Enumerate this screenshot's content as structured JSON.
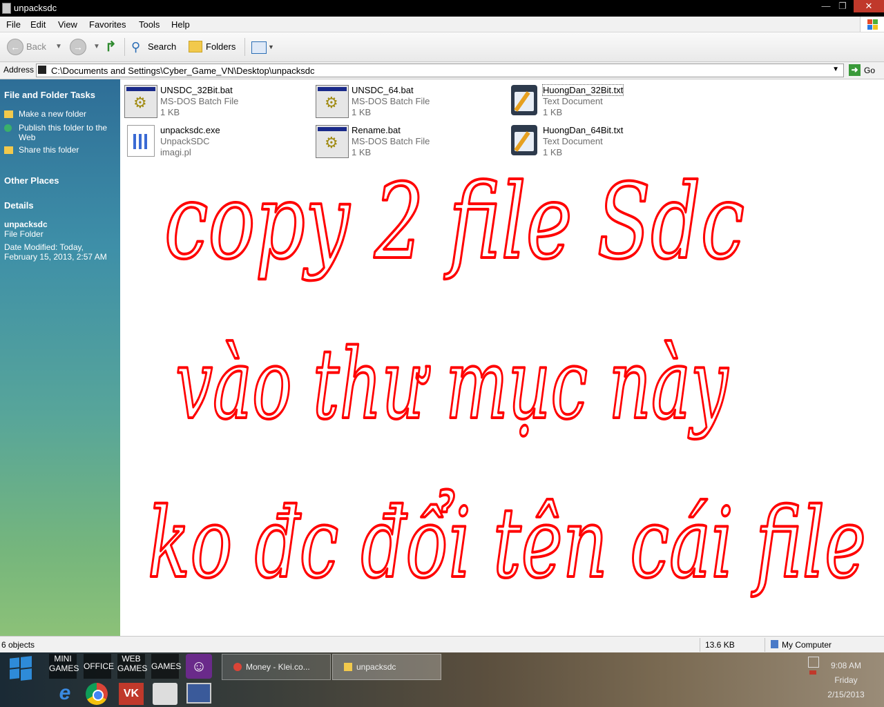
{
  "window": {
    "title": "unpacksdc"
  },
  "menu": {
    "items": [
      "File",
      "Edit",
      "View",
      "Favorites",
      "Tools",
      "Help"
    ]
  },
  "toolbar": {
    "back_label": "Back",
    "search_label": "Search",
    "folders_label": "Folders"
  },
  "address": {
    "label": "Address",
    "path": "C:\\Documents and Settings\\Cyber_Game_VN\\Desktop\\unpacksdc",
    "go_label": "Go"
  },
  "left_pane": {
    "tasks_title": "File and Folder Tasks",
    "tasks": [
      "Make a new folder",
      "Publish this folder to the Web",
      "Share this folder"
    ],
    "other_places_title": "Other Places",
    "details_title": "Details",
    "details": {
      "name": "unpacksdc",
      "type": "File Folder",
      "modified": "Date Modified: Today, February 15, 2013, 2:57 AM"
    }
  },
  "files": [
    {
      "name": "UNSDC_32Bit.bat",
      "type": "MS-DOS Batch File",
      "size": "1 KB",
      "icon": "batch-file-icon"
    },
    {
      "name": "UNSDC_64.bat",
      "type": "MS-DOS Batch File",
      "size": "1 KB",
      "icon": "batch-file-icon"
    },
    {
      "name": "HuongDan_32Bit.txt",
      "type": "Text Document",
      "size": "1 KB",
      "icon": "text-file-icon"
    },
    {
      "name": "unpacksdc.exe",
      "type": "UnpackSDC",
      "size": "imagi.pl",
      "icon": "exe-file-icon"
    },
    {
      "name": "Rename.bat",
      "type": "MS-DOS Batch File",
      "size": "1 KB",
      "icon": "batch-file-icon"
    },
    {
      "name": "HuongDan_64Bit.txt",
      "type": "Text Document",
      "size": "1 KB",
      "icon": "text-file-icon"
    }
  ],
  "annotation": {
    "line1": "copy 2 file Sdc",
    "line2": "vào thư mục này",
    "line3": "ko đc đổi tên cái file",
    "color": "#ff0000"
  },
  "status": {
    "objects": "6 objects",
    "size": "13.6 KB",
    "zone": "My Computer"
  },
  "taskbar": {
    "quicklaunch": [
      "MINI GAMES",
      "OFFICE",
      "WEB GAMES",
      "GAMES"
    ],
    "tasks": [
      "Money - Klei.co...",
      "unpacksdc"
    ],
    "clock": {
      "time": "9:08 AM",
      "day": "Friday",
      "date": "2/15/2013"
    }
  }
}
